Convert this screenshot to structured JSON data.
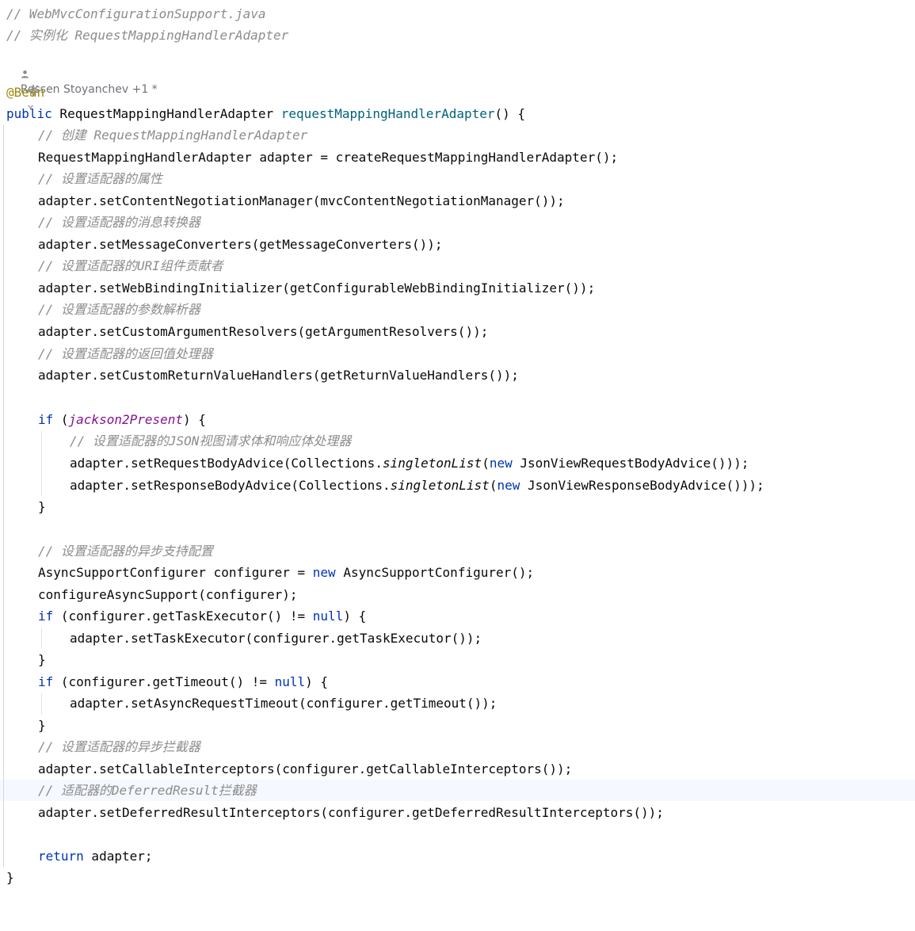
{
  "header_comments": {
    "filename": "// WebMvcConfigurationSupport.java",
    "description": "// 实例化 RequestMappingHandlerAdapter"
  },
  "author_hint": {
    "text": "Rossen Stoyanchev +1 *"
  },
  "code": {
    "annotation": "@Bean",
    "kw_public": "public",
    "return_type": " RequestMappingHandlerAdapter ",
    "method_name": "requestMappingHandlerAdapter",
    "method_tail": "() {",
    "c_create": "// 创建 RequestMappingHandlerAdapter",
    "l_create": "RequestMappingHandlerAdapter adapter = createRequestMappingHandlerAdapter();",
    "c_props": "// 设置适配器的属性",
    "l_props": "adapter.setContentNegotiationManager(mvcContentNegotiationManager());",
    "c_conv": "// 设置适配器的消息转换器",
    "l_conv": "adapter.setMessageConverters(getMessageConverters());",
    "c_uri": "// 设置适配器的URI组件贡献者",
    "l_uri": "adapter.setWebBindingInitializer(getConfigurableWebBindingInitializer());",
    "c_args": "// 设置适配器的参数解析器",
    "l_args": "adapter.setCustomArgumentResolvers(getArgumentResolvers());",
    "c_ret": "// 设置适配器的返回值处理器",
    "l_ret": "adapter.setCustomReturnValueHandlers(getReturnValueHandlers());",
    "if_kw": "if",
    "if_open": " (",
    "jackson_field": "jackson2Present",
    "if_close": ") {",
    "c_json": "// 设置适配器的JSON视图请求体和响应体处理器",
    "req_a": "adapter.setRequestBodyAdvice(Collections.",
    "singleton": "singletonList",
    "paren_open": "(",
    "new_kw": "new",
    "req_b": " JsonViewRequestBodyAdvice()));",
    "resp_a": "adapter.setResponseBodyAdvice(Collections.",
    "resp_b": " JsonViewResponseBodyAdvice()));",
    "close_brace": "}",
    "c_async": "// 设置适配器的异步支持配置",
    "async_a": "AsyncSupportConfigurer configurer = ",
    "async_b": " AsyncSupportConfigurer();",
    "configure_line": "configureAsyncSupport(configurer);",
    "exec_cond": " (configurer.getTaskExecutor() != ",
    "null_kw": "null",
    "brace_tail": ") {",
    "exec_set": "adapter.setTaskExecutor(configurer.getTaskExecutor());",
    "timeout_cond": " (configurer.getTimeout() != ",
    "timeout_set": "adapter.setAsyncRequestTimeout(configurer.getTimeout());",
    "c_callable": "// 设置适配器的异步拦截器",
    "l_callable": "adapter.setCallableInterceptors(configurer.getCallableInterceptors());",
    "c_deferred": "// 适配器的DeferredResult拦截器",
    "l_deferred": "adapter.setDeferredResultInterceptors(configurer.getDeferredResultInterceptors());",
    "return_kw": "return",
    "return_tail": " adapter;"
  },
  "colors": {
    "keyword": "#0033b3",
    "comment": "#8c8c8c",
    "annotation": "#9e880d",
    "method_declaration": "#00627a",
    "field": "#871094",
    "current_line": "#f5f8fe"
  },
  "icons": [
    "person-icon",
    "ai-sparkle-icon",
    "chevron-down-icon"
  ]
}
